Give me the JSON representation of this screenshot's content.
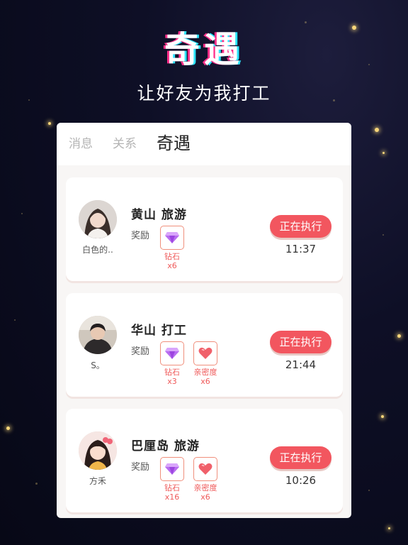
{
  "header": {
    "title": "奇遇",
    "subtitle": "让好友为我打工"
  },
  "tabs": [
    {
      "label": "消息",
      "active": false
    },
    {
      "label": "关系",
      "active": false
    },
    {
      "label": "奇遇",
      "active": true
    }
  ],
  "tasks": [
    {
      "user": "白色的..",
      "title": "黄山  旅游",
      "reward_label": "奖励",
      "rewards": [
        {
          "name": "钻石",
          "count": "x6",
          "icon": "diamond-icon"
        }
      ],
      "status": "正在执行",
      "time": "11:37"
    },
    {
      "user": "S。",
      "title": "华山  打工",
      "reward_label": "奖励",
      "rewards": [
        {
          "name": "钻石",
          "count": "x3",
          "icon": "diamond-icon"
        },
        {
          "name": "亲密度",
          "count": "x6",
          "icon": "heart-icon"
        }
      ],
      "status": "正在执行",
      "time": "21:44"
    },
    {
      "user": "方禾",
      "title": "巴厘岛  旅游",
      "reward_label": "奖励",
      "rewards": [
        {
          "name": "钻石",
          "count": "x16",
          "icon": "diamond-icon"
        },
        {
          "name": "亲密度",
          "count": "x6",
          "icon": "heart-icon"
        }
      ],
      "status": "正在执行",
      "time": "10:26"
    }
  ],
  "colors": {
    "accent": "#f2565f",
    "reward_border": "#f08f7c",
    "reward_text": "#ef5a5a"
  }
}
